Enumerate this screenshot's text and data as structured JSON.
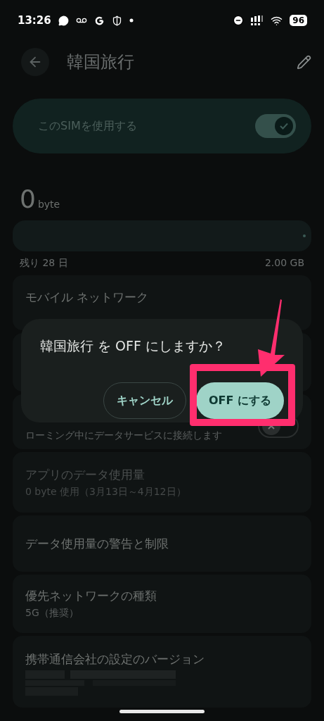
{
  "status_bar": {
    "time": "13:26",
    "battery": "96"
  },
  "header": {
    "title": "韓国旅行"
  },
  "sim_switch": {
    "label": "このSIMを使用する",
    "on": true
  },
  "usage": {
    "amount": "0",
    "unit": "byte",
    "remaining": "残り 28 日",
    "limit": "2.00 GB"
  },
  "settings": [
    {
      "kind": "link",
      "title": "モバイル ネットワーク"
    },
    {
      "kind": "blank"
    },
    {
      "kind": "toggle",
      "subtitle": "ローミング中にデータサービスに接続します",
      "on": false
    },
    {
      "kind": "link",
      "title": "アプリのデータ使用量",
      "subtitle": "0 byte 使用（3月13日～4月12日）",
      "disabled": true
    },
    {
      "kind": "link",
      "title": "データ使用量の警告と制限"
    },
    {
      "kind": "link",
      "title": "優先ネットワークの種類",
      "subtitle": "5G（推奨）"
    },
    {
      "kind": "redacted",
      "title": "携帯通信会社の設定のバージョン"
    }
  ],
  "dialog": {
    "message": "韓国旅行 を OFF にしますか？",
    "buttons": [
      {
        "label": "キャンセル",
        "kind": "outline"
      },
      {
        "label": "OFF にする",
        "kind": "filled",
        "highlighted": true
      }
    ]
  }
}
